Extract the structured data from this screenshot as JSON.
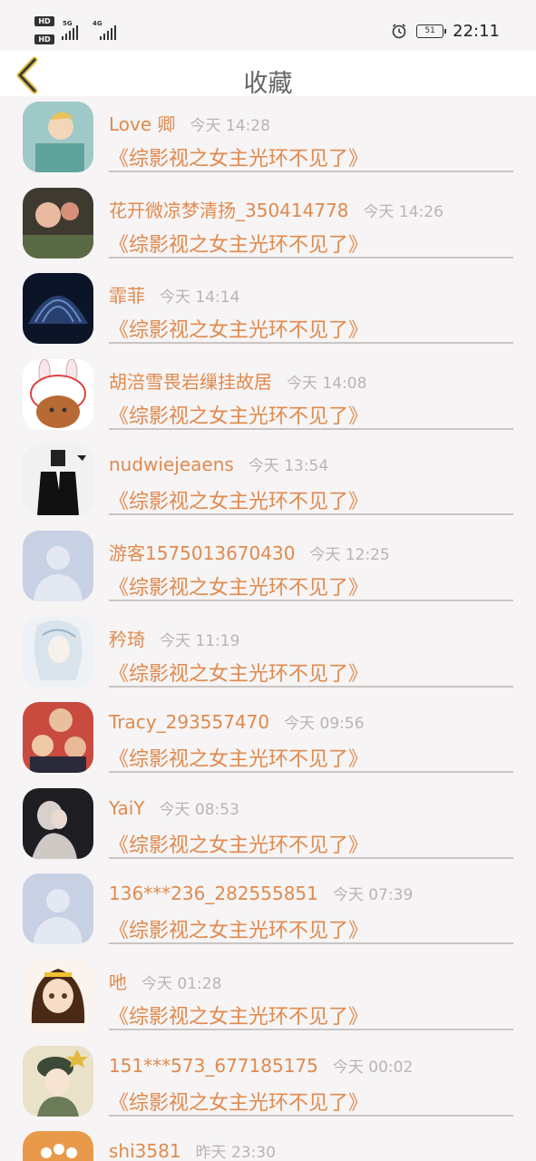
{
  "status_bar": {
    "sim1_badge": "HD",
    "sim2_badge": "HD",
    "net1": "5G",
    "net2": "4G",
    "battery": "51",
    "time": "22:11",
    "icons": [
      "alarm-icon",
      "battery-icon",
      "signal-icon"
    ]
  },
  "header": {
    "title": "收藏",
    "back_icon": "chevron-left-icon",
    "accent": "#e08a4f"
  },
  "items": [
    {
      "name": "Love 卿",
      "time": "今天 14:28",
      "novel": "《综影视之女主光环不见了》",
      "avatar": "photo"
    },
    {
      "name": "花开微凉梦清扬_350414778",
      "time": "今天 14:26",
      "novel": "《综影视之女主光环不见了》",
      "avatar": "photo"
    },
    {
      "name": "霏菲",
      "time": "今天 14:14",
      "novel": "《综影视之女主光环不见了》",
      "avatar": "photo"
    },
    {
      "name": "胡涪雪畏岩缫挂故居",
      "time": "今天 14:08",
      "novel": "《综影视之女主光环不见了》",
      "avatar": "cartoon"
    },
    {
      "name": "nudwiejeaens",
      "time": "今天 13:54",
      "novel": "《综影视之女主光环不见了》",
      "avatar": "photo"
    },
    {
      "name": "游客1575013670430",
      "time": "今天 12:25",
      "novel": "《综影视之女主光环不见了》",
      "avatar": "default"
    },
    {
      "name": "矜琦",
      "time": "今天 11:19",
      "novel": "《综影视之女主光环不见了》",
      "avatar": "illustration"
    },
    {
      "name": "Tracy_293557470",
      "time": "今天 09:56",
      "novel": "《综影视之女主光环不见了》",
      "avatar": "photo"
    },
    {
      "name": "YaiY",
      "time": "今天 08:53",
      "novel": "《综影视之女主光环不见了》",
      "avatar": "photo"
    },
    {
      "name": "136***236_282555851",
      "time": "今天 07:39",
      "novel": "《综影视之女主光环不见了》",
      "avatar": "default"
    },
    {
      "name": "吔",
      "time": "今天 01:28",
      "novel": "《综影视之女主光环不见了》",
      "avatar": "anime"
    },
    {
      "name": "151***573_677185175",
      "time": "今天 00:02",
      "novel": "《综影视之女主光环不见了》",
      "avatar": "illustration"
    },
    {
      "name": "shi3581",
      "time": "昨天 23:30",
      "novel": "",
      "avatar": "photo"
    }
  ]
}
